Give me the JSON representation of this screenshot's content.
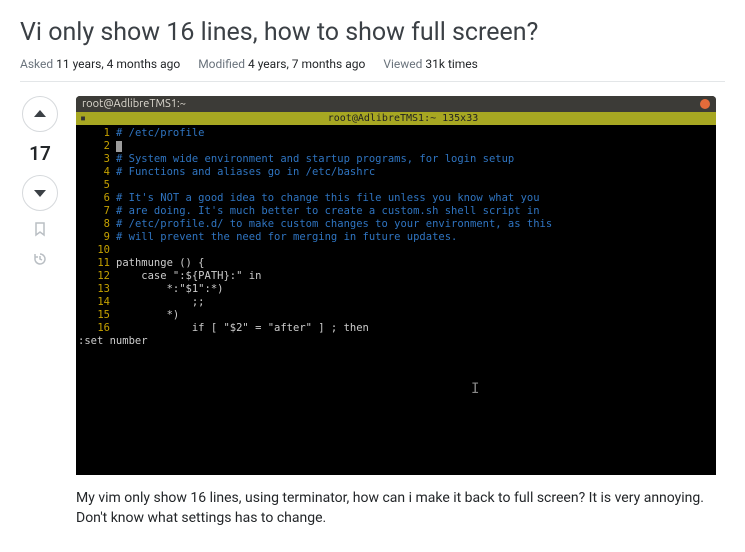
{
  "title": "Vi only show 16 lines, how to show full screen?",
  "meta": {
    "asked_label": "Asked",
    "asked_value": "11 years, 4 months ago",
    "modified_label": "Modified",
    "modified_value": "4 years, 7 months ago",
    "viewed_label": "Viewed",
    "viewed_value": "31k times"
  },
  "score": "17",
  "terminal": {
    "window_title": "root@AdlibreTMS1:~",
    "status_text": "root@AdlibreTMS1:~ 135x33",
    "lines": [
      {
        "n": "1",
        "cls": "cm",
        "t": "# /etc/profile"
      },
      {
        "n": "2",
        "cls": "txt",
        "t": ""
      },
      {
        "n": "3",
        "cls": "cm",
        "t": "# System wide environment and startup programs, for login setup"
      },
      {
        "n": "4",
        "cls": "cm",
        "t": "# Functions and aliases go in /etc/bashrc"
      },
      {
        "n": "5",
        "cls": "txt",
        "t": ""
      },
      {
        "n": "6",
        "cls": "cm",
        "t": "# It's NOT a good idea to change this file unless you know what you"
      },
      {
        "n": "7",
        "cls": "cm",
        "t": "# are doing. It's much better to create a custom.sh shell script in"
      },
      {
        "n": "8",
        "cls": "cm",
        "t": "# /etc/profile.d/ to make custom changes to your environment, as this"
      },
      {
        "n": "9",
        "cls": "cm",
        "t": "# will prevent the need for merging in future updates."
      },
      {
        "n": "10",
        "cls": "txt",
        "t": ""
      },
      {
        "n": "11",
        "cls": "txt",
        "t": "pathmunge () {"
      },
      {
        "n": "12",
        "cls": "txt",
        "t": "    case \":${PATH}:\" in"
      },
      {
        "n": "13",
        "cls": "txt",
        "t": "        *:\"$1\":*)"
      },
      {
        "n": "14",
        "cls": "txt",
        "t": "            ;;"
      },
      {
        "n": "15",
        "cls": "txt",
        "t": "        *)"
      },
      {
        "n": "16",
        "cls": "txt",
        "t": "            if [ \"$2\" = \"after\" ] ; then"
      }
    ],
    "ex_command": ":set number"
  },
  "body_text": "My vim only show 16 lines, using terminator, how can i make it back to full screen? It is very annoying. Don't know what settings has to change."
}
